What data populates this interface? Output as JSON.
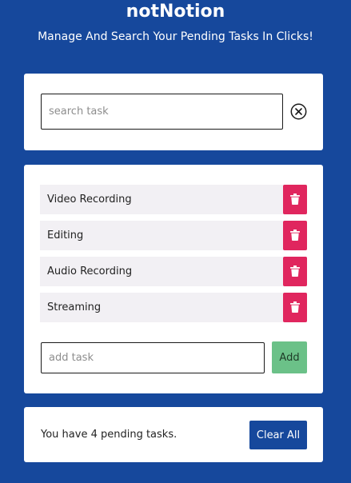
{
  "header": {
    "title": "notNotion",
    "subtitle": "Manage And Search Your Pending Tasks In Clicks!"
  },
  "search": {
    "placeholder": "search task",
    "value": "",
    "clear_icon": "circle-x-icon"
  },
  "tasks": [
    {
      "label": "Video Recording",
      "delete_icon": "trash-icon"
    },
    {
      "label": "Editing",
      "delete_icon": "trash-icon"
    },
    {
      "label": "Audio Recording",
      "delete_icon": "trash-icon"
    },
    {
      "label": "Streaming",
      "delete_icon": "trash-icon"
    }
  ],
  "add_task": {
    "placeholder": "add task",
    "value": "",
    "button_label": "Add"
  },
  "footer": {
    "pending_text": "You have 4 pending tasks.",
    "clear_all_label": "Clear All"
  },
  "colors": {
    "background": "#16489c",
    "card": "#ffffff",
    "task_row": "#f2f0f4",
    "delete": "#e0265e",
    "add": "#6bc188",
    "clear_all": "#16489c"
  }
}
